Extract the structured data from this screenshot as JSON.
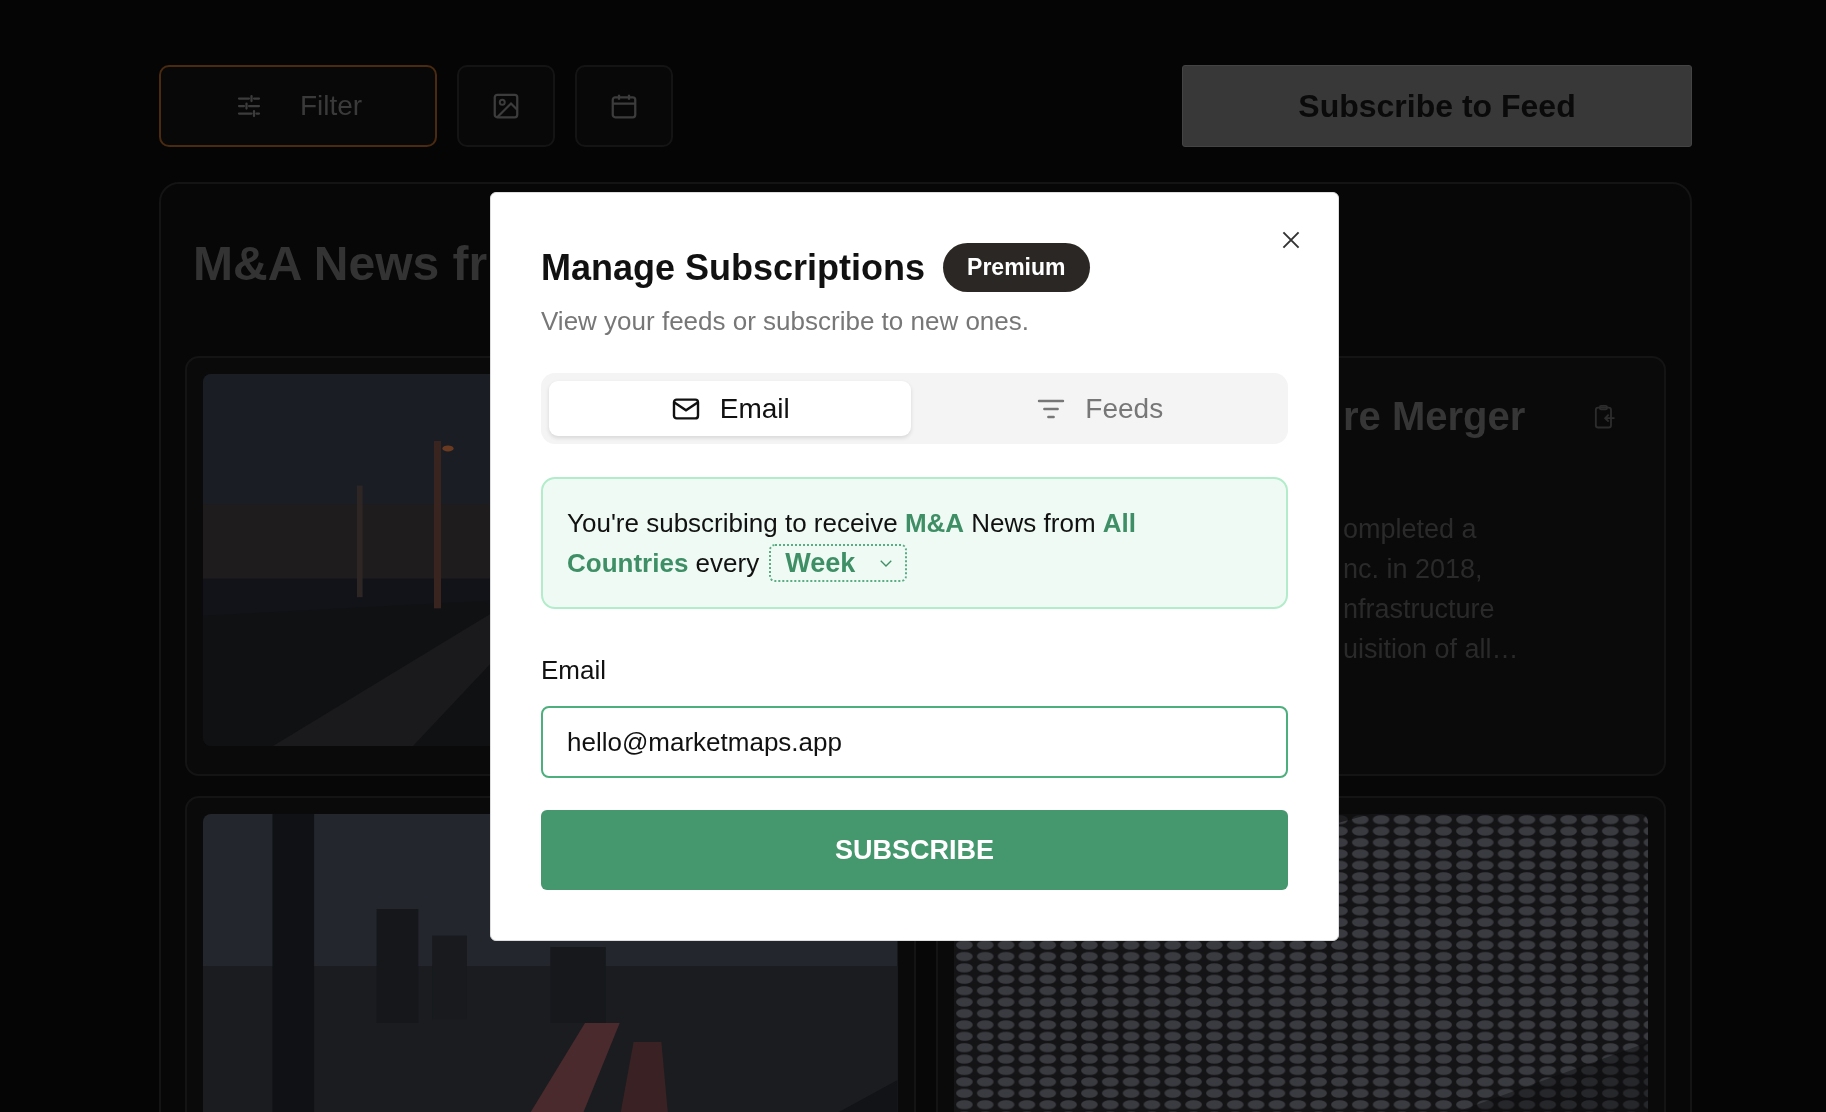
{
  "toolbar": {
    "filter": "Filter",
    "subscribe": "Subscribe to Feed"
  },
  "panel": {
    "title": "M&A News fr",
    "featured": {
      "title": "re Merger",
      "excerpt": "ompleted a\nnc. in 2018,\nnfrastructure\nuisition of all…"
    }
  },
  "modal": {
    "title": "Manage Subscriptions",
    "badge": "Premium",
    "subtitle": "View your feeds or subscribe to new ones.",
    "tabs": [
      {
        "label": "Email",
        "kind": "email",
        "selected": true
      },
      {
        "label": "Feeds",
        "kind": "feeds",
        "selected": false
      }
    ],
    "notice_lines": [
      "You're subscribing to receive **M&A** News from **All**",
      "**Countries** every"
    ],
    "frequency": "Week",
    "email_label": "Email",
    "email_value": "hello@marketmaps.app",
    "submit": "SUBSCRIBE"
  }
}
